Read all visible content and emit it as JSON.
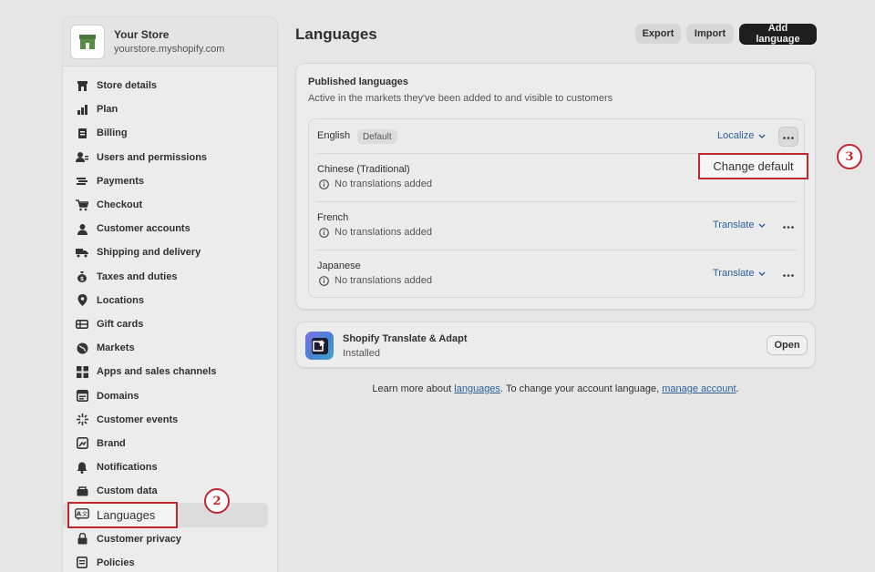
{
  "store": {
    "name": "Your Store",
    "domain": "yourstore.myshopify.com"
  },
  "sidebar": {
    "items": [
      {
        "label": "Store details",
        "icon": "store-icon"
      },
      {
        "label": "Plan",
        "icon": "chart-bar-icon"
      },
      {
        "label": "Billing",
        "icon": "receipt-icon"
      },
      {
        "label": "Users and permissions",
        "icon": "users-icon"
      },
      {
        "label": "Payments",
        "icon": "payments-icon"
      },
      {
        "label": "Checkout",
        "icon": "cart-icon"
      },
      {
        "label": "Customer accounts",
        "icon": "person-icon"
      },
      {
        "label": "Shipping and delivery",
        "icon": "truck-icon"
      },
      {
        "label": "Taxes and duties",
        "icon": "money-bag-icon"
      },
      {
        "label": "Locations",
        "icon": "location-pin-icon"
      },
      {
        "label": "Gift cards",
        "icon": "gift-card-icon"
      },
      {
        "label": "Markets",
        "icon": "globe-icon"
      },
      {
        "label": "Apps and sales channels",
        "icon": "apps-icon"
      },
      {
        "label": "Domains",
        "icon": "domain-icon"
      },
      {
        "label": "Customer events",
        "icon": "sparkle-icon"
      },
      {
        "label": "Brand",
        "icon": "brand-icon"
      },
      {
        "label": "Notifications",
        "icon": "bell-icon"
      },
      {
        "label": "Custom data",
        "icon": "database-icon"
      },
      {
        "label": "Languages",
        "icon": "translate-icon",
        "active": true
      },
      {
        "label": "Customer privacy",
        "icon": "lock-icon"
      },
      {
        "label": "Policies",
        "icon": "policy-icon"
      }
    ]
  },
  "header": {
    "title": "Languages",
    "export_label": "Export",
    "import_label": "Import",
    "add_label": "Add language"
  },
  "published": {
    "title": "Published languages",
    "subtitle": "Active in the markets they've been added to and visible to customers",
    "languages": [
      {
        "name": "English",
        "badge": "Default",
        "action": "Localize"
      },
      {
        "name": "Chinese (Traditional)",
        "status": "No translations added"
      },
      {
        "name": "French",
        "status": "No translations added",
        "action": "Translate"
      },
      {
        "name": "Japanese",
        "status": "No translations added",
        "action": "Translate"
      }
    ]
  },
  "popover": {
    "change_default": "Change default"
  },
  "app": {
    "name": "Shopify Translate & Adapt",
    "status": "Installed",
    "open_label": "Open"
  },
  "footer": {
    "prefix": "Learn more about ",
    "languages_link": "languages",
    "middle": ". To change your account language, ",
    "account_link": "manage account",
    "suffix": "."
  },
  "steps": {
    "step2": "2",
    "step3": "3"
  },
  "colors": {
    "accent": "#c0282d",
    "link": "#2b5f9c",
    "primary_button": "#1e1e1e",
    "store_logo": "#4a7a3a"
  }
}
